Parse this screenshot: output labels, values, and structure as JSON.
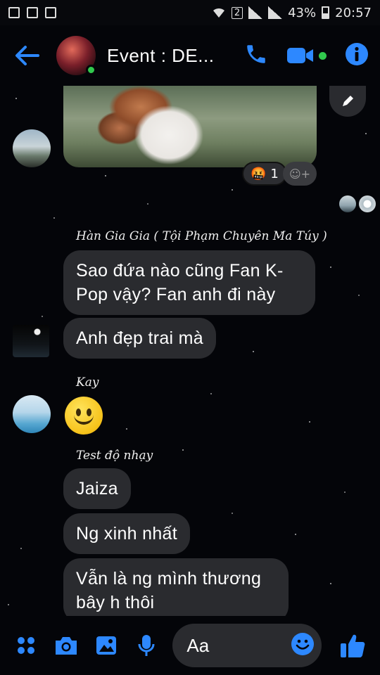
{
  "status_bar": {
    "battery": "43%",
    "time": "20:57",
    "sim_slot": "2"
  },
  "header": {
    "title": "Event : DE...",
    "icons": [
      "back-arrow-icon",
      "phone-icon",
      "video-call-icon",
      "info-icon"
    ]
  },
  "colors": {
    "accent": "#2d88ff",
    "online": "#31c94d",
    "bubble": "#2a2b2f",
    "background": "#05060a"
  },
  "photo_message": {
    "reaction_emoji": "🤬",
    "reaction_count": "1",
    "add_reaction_label": "☺+"
  },
  "messages": [
    {
      "sender": "Hàn Gia Gia ( Tội Phạm Chuyên Ma Túy )",
      "bubbles": [
        "Sao đứa nào cũng Fan K-Pop vậy? Fan anh đi này",
        "Anh đẹp trai mà"
      ]
    },
    {
      "sender": "Kay",
      "bubbles": []
    },
    {
      "sender": "Test độ nhạy",
      "bubbles": [
        "Jaiza",
        "Ng xinh nhất",
        "Vẫn là ng mình thương bây h thôi"
      ]
    }
  ],
  "composer": {
    "placeholder": "Aa",
    "icons": [
      "apps-grid-icon",
      "camera-icon",
      "gallery-icon",
      "microphone-icon",
      "emoji-icon",
      "thumbs-up-icon"
    ]
  }
}
